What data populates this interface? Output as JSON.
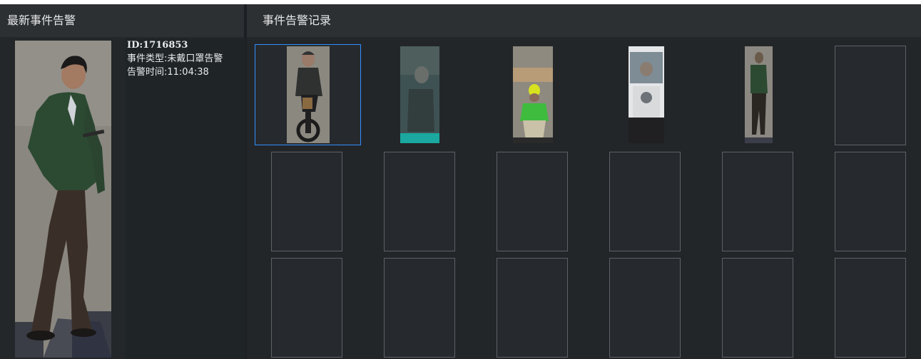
{
  "latest_alarm": {
    "title": "最新事件告警",
    "id_text": "ID:1716853",
    "type_text": "事件类型:未戴口罩告警",
    "time_text": "告警时间:11:04:38"
  },
  "alarm_records": {
    "title": "事件告警记录",
    "filled_slots": 5,
    "total_slots": 18
  },
  "colors": {
    "background": "#1c1f23",
    "header": "#2d3033",
    "slot_border": "#5d6167",
    "selected_border": "#2e8fff"
  }
}
